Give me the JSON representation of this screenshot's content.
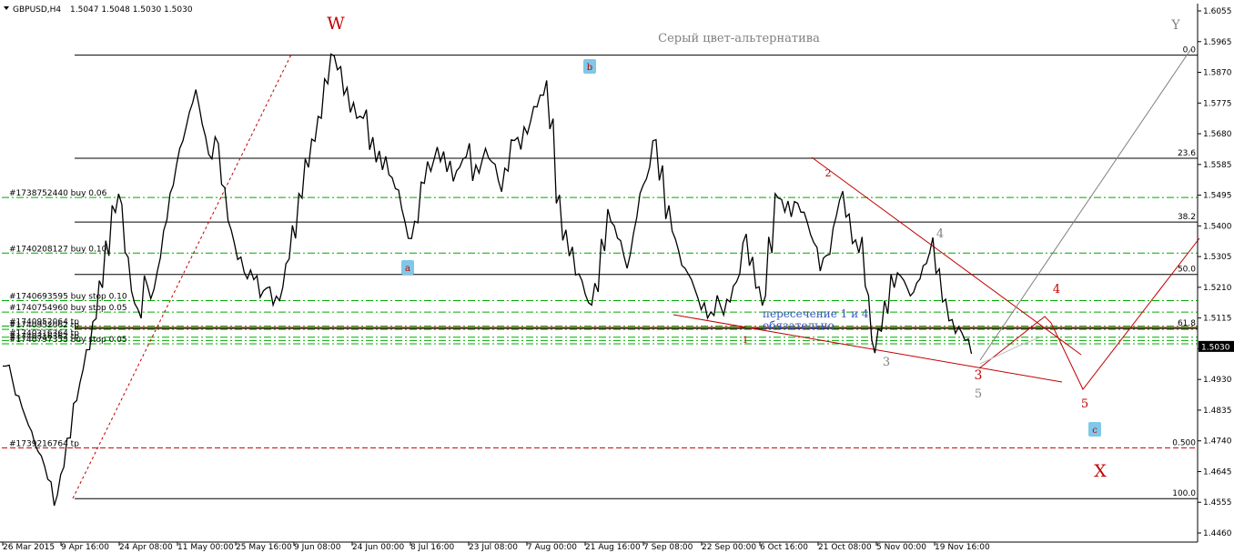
{
  "header": {
    "symbol": "GBPUSD,H4",
    "ohlc": "1.5047 1.5048 1.5030 1.5030"
  },
  "colors": {
    "background": "#ffffff",
    "price": "#000000",
    "fib": "#000000",
    "order": "#00aa00",
    "wave_red": "#c00000",
    "wave_grey": "#808080",
    "note_blue": "#3355bb",
    "label_box": "#7fc8e8"
  },
  "annotations": {
    "title_note": "Серый цвет-альтернатива",
    "cross_note_line1": "пересечение 1 и 4",
    "cross_note_line2": "обязательно"
  },
  "chart_data": {
    "type": "line",
    "title": "GBPUSD,H4",
    "ylim": [
      1.446,
      1.6055
    ],
    "current_price": "1.5030",
    "y_ticks": [
      "1.6055",
      "1.5965",
      "1.5870",
      "1.5775",
      "1.5680",
      "1.5585",
      "1.5495",
      "1.5400",
      "1.5305",
      "1.5210",
      "1.5115",
      "1.5020",
      "1.4930",
      "1.4835",
      "1.4740",
      "1.4645",
      "1.4555",
      "1.4460"
    ],
    "x_ticks": [
      "26 Mar 2015",
      "9 Apr 16:00",
      "24 Apr 08:00",
      "11 May 00:00",
      "25 May 16:00",
      "9 Jun 08:00",
      "24 Jun 00:00",
      "8 Jul 16:00",
      "23 Jul 08:00",
      "7 Aug 00:00",
      "21 Aug 16:00",
      "7 Sep 08:00",
      "22 Sep 00:00",
      "6 Oct 16:00",
      "21 Oct 08:00",
      "5 Nov 00:00",
      "19 Nov 16:00"
    ],
    "series": [
      {
        "values": [
          1.497,
          1.495,
          1.488,
          1.483,
          1.478,
          1.472,
          1.468,
          1.462,
          1.456,
          1.465,
          1.475,
          1.486,
          1.494,
          1.502,
          1.511,
          1.522,
          1.533,
          1.545,
          1.548,
          1.531,
          1.518,
          1.513,
          1.523,
          1.519,
          1.528,
          1.54,
          1.551,
          1.561,
          1.568,
          1.576,
          1.579,
          1.569,
          1.561,
          1.566,
          1.552,
          1.54,
          1.532,
          1.528,
          1.525,
          1.524,
          1.519,
          1.521,
          1.517,
          1.519,
          1.529,
          1.538,
          1.549,
          1.559,
          1.566,
          1.573,
          1.584,
          1.592,
          1.588,
          1.581,
          1.576,
          1.573,
          1.574,
          1.565,
          1.561,
          1.559,
          1.555,
          1.551,
          1.543,
          1.536,
          1.541,
          1.553,
          1.558,
          1.562,
          1.561,
          1.558,
          1.555,
          1.559,
          1.563,
          1.556,
          1.558,
          1.562,
          1.559,
          1.552,
          1.557,
          1.566,
          1.565,
          1.569,
          1.574,
          1.578,
          1.582,
          1.571,
          1.548,
          1.537,
          1.532,
          1.525,
          1.521,
          1.516,
          1.521,
          1.534,
          1.543,
          1.538,
          1.533,
          1.529,
          1.54,
          1.551,
          1.556,
          1.566,
          1.556,
          1.544,
          1.537,
          1.53,
          1.526,
          1.522,
          1.516,
          1.514,
          1.513,
          1.517,
          1.515,
          1.519,
          1.524,
          1.536,
          1.529,
          1.521,
          1.517,
          1.534,
          1.549,
          1.546,
          1.545,
          1.547,
          1.544,
          1.539,
          1.534,
          1.528,
          1.531,
          1.541,
          1.549,
          1.543,
          1.535,
          1.534,
          1.52,
          1.503,
          1.508,
          1.515,
          1.523,
          1.525,
          1.522,
          1.519,
          1.523,
          1.528,
          1.534,
          1.526,
          1.517,
          1.511,
          1.508,
          1.506,
          1.503
        ]
      }
    ],
    "fibonacci_levels": [
      {
        "label": "0.0",
        "price": 1.592
      },
      {
        "label": "23.6",
        "price": 1.5605
      },
      {
        "label": "38.2",
        "price": 1.541
      },
      {
        "label": "50.0",
        "price": 1.525
      },
      {
        "label": "61.8",
        "price": 1.5085
      },
      {
        "label": "0.500",
        "price": 1.472
      },
      {
        "label": "100.0",
        "price": 1.4565
      }
    ],
    "orders": [
      {
        "label": "#1738752440 buy 0.06",
        "price": 1.5485
      },
      {
        "label": "#1740208127 buy 0.10",
        "price": 1.5315
      },
      {
        "label": "#1740693595 buy stop 0.10",
        "price": 1.517
      },
      {
        "label": "#1740754960 buy stop 0.05",
        "price": 1.5135
      },
      {
        "label": "#1740952064 tp",
        "price": 1.5092
      },
      {
        "label": "#1740952062 tp",
        "price": 1.5082
      },
      {
        "label": "#1740316364 tp",
        "price": 1.5058
      },
      {
        "label": "#1740316362 tp",
        "price": 1.5048
      },
      {
        "label": "#1740797353 buy stop 0.05",
        "price": 1.5038
      },
      {
        "label": "#1739216764 tp",
        "price": 1.472
      }
    ],
    "wave_labels": {
      "W": "W",
      "X": "X",
      "Y": "Y",
      "a": "a",
      "b": "b",
      "c": "c",
      "r1": "1",
      "r2": "2",
      "r3": "3",
      "r4": "4",
      "r5": "5",
      "g3": "3",
      "g4": "4",
      "g5": "5"
    }
  }
}
